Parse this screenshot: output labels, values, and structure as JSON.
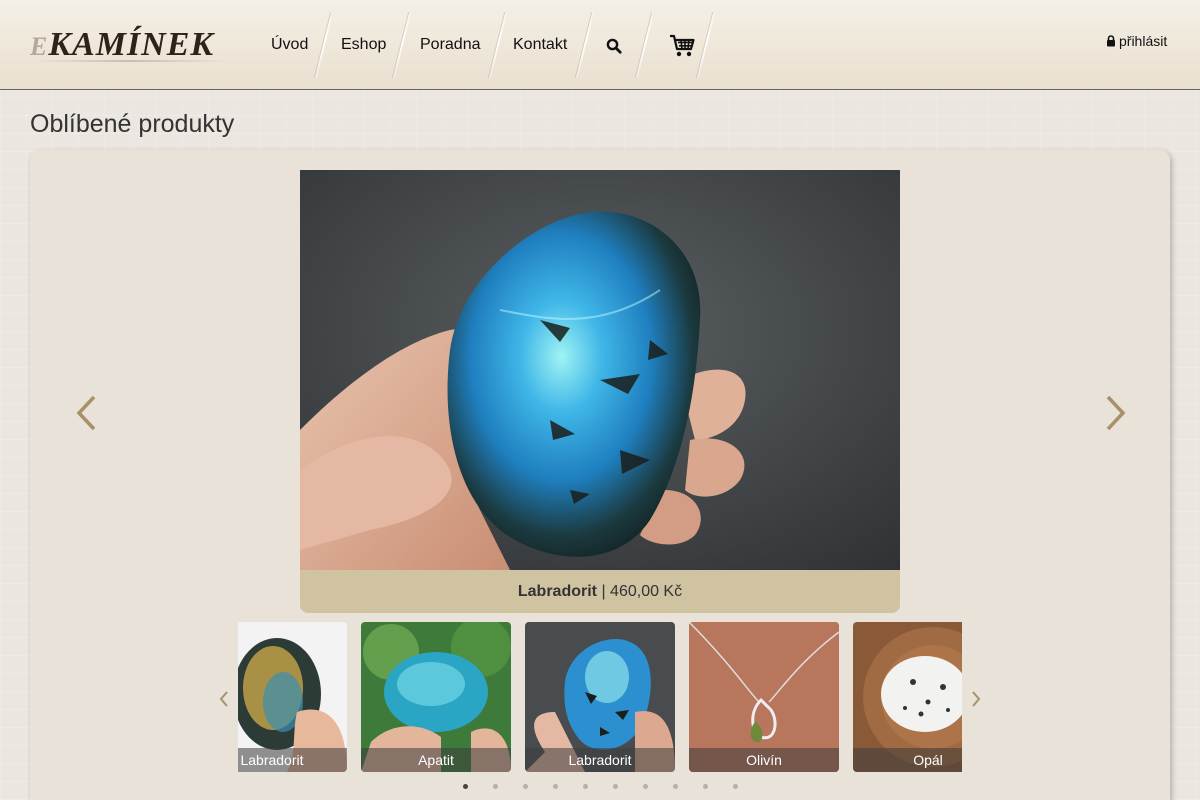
{
  "header": {
    "logo_prefix": "E",
    "logo_text": "KAMÍNEK",
    "nav": [
      {
        "label": "Úvod"
      },
      {
        "label": "Eshop"
      },
      {
        "label": "Poradna"
      },
      {
        "label": "Kontakt"
      }
    ],
    "search_icon": "search-icon",
    "cart_icon": "shopping-cart-icon",
    "login_icon": "lock-icon",
    "login_label": "přihlásit"
  },
  "main": {
    "title": "Oblíbené produkty",
    "featured": {
      "name": "Labradorit",
      "separator": " | ",
      "price": "460,00 Kč"
    },
    "thumbnails": [
      {
        "label": "Labradorit"
      },
      {
        "label": "Apatit"
      },
      {
        "label": "Labradorit"
      },
      {
        "label": "Olivín"
      },
      {
        "label": "Opál"
      }
    ],
    "dot_count": 10,
    "active_dot": 0
  },
  "colors": {
    "caption_bg": "#cfc3a2",
    "arrow": "#a8906a",
    "header_border": "#6d655c"
  }
}
